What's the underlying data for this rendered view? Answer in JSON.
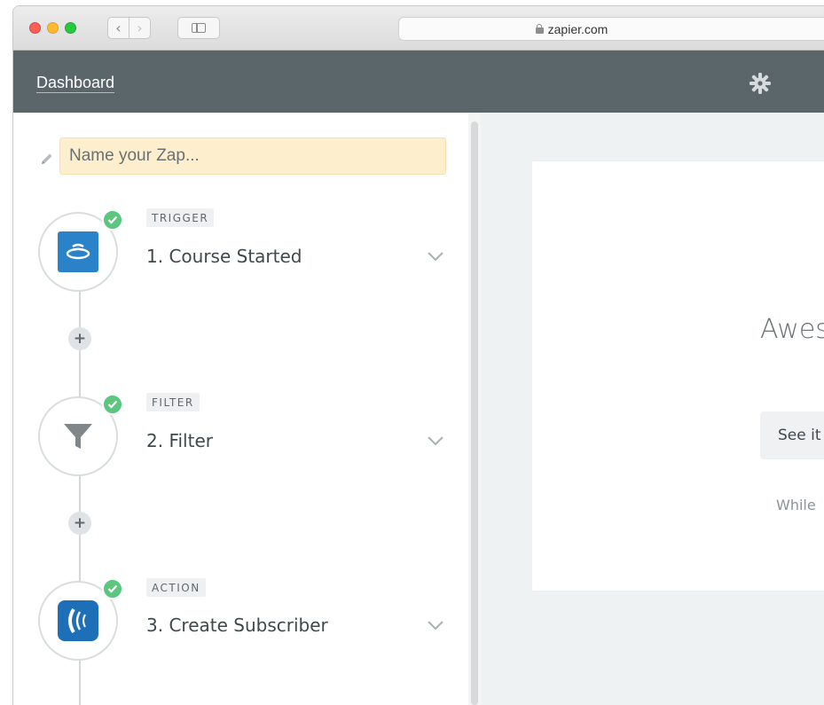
{
  "browser": {
    "url": "zapier.com",
    "back_glyph": "‹",
    "forward_glyph": "›"
  },
  "header": {
    "dashboard_label": "Dashboard",
    "settings_icon": "gear-icon"
  },
  "editor": {
    "zap_name_placeholder": "Name your Zap...",
    "steps": [
      {
        "tag": "TRIGGER",
        "title": "1. Course Started",
        "icon": "course-app-logo",
        "status": "complete"
      },
      {
        "tag": "FILTER",
        "title": "2. Filter",
        "icon": "filter-funnel-icon",
        "status": "complete"
      },
      {
        "tag": "ACTION",
        "title": "3. Create Subscriber",
        "icon": "campaign-monitor-logo",
        "status": "complete"
      }
    ],
    "add_step_glyph": "+"
  },
  "panel": {
    "heading": "Awes",
    "button_label": "See it",
    "note": "While"
  },
  "colors": {
    "header_bg": "#5b666b",
    "check_green": "#5bc67d",
    "zap_name_bg": "#fdeece",
    "panel_bg": "#eff2f2"
  }
}
